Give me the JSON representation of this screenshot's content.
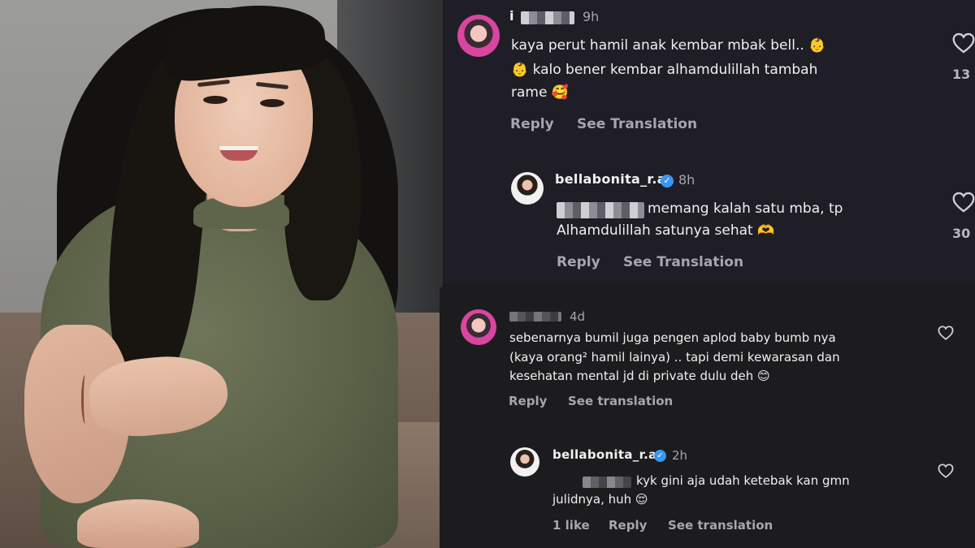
{
  "comments_top": {
    "comment": {
      "username": "i",
      "time": "9h",
      "lines": [
        "kaya perut hamil anak kembar mbak bell.. 👶",
        "👶 kalo bener kembar alhamdulillah tambah",
        "rame 🥰"
      ],
      "reply_label": "Reply",
      "translate_label": "See Translation",
      "likes": "13"
    },
    "reply": {
      "username": "bellabonita_r.a",
      "time": "8h",
      "lines": [
        "memang kalah satu mba, tp",
        "Alhamdulillah satunya sehat 🫶"
      ],
      "reply_label": "Reply",
      "translate_label": "See Translation",
      "likes": "30"
    }
  },
  "comments_bottom": {
    "comment": {
      "time": "4d",
      "lines": [
        "sebenarnya bumil juga pengen aplod baby bumb nya",
        "(kaya orang² hamil lainya) .. tapi demi kewarasan dan",
        "kesehatan mental jd di private dulu deh 😊"
      ],
      "reply_label": "Reply",
      "translate_label": "See translation"
    },
    "reply": {
      "username": "bellabonita_r.a",
      "time": "2h",
      "lines": [
        "kyk gini aja udah ketebak kan gmn",
        "julidnya, huh 😌"
      ],
      "likes_label": "1 like",
      "reply_label": "Reply",
      "translate_label": "See translation"
    }
  },
  "icons": {
    "heart": "heart-icon",
    "verified": "verified-badge-icon",
    "avatar": "avatar"
  },
  "colors": {
    "panel_top_bg": "#1f1e27",
    "panel_bottom_bg": "#1c1c1e",
    "verified": "#3897f0",
    "muted_text": "#a6a6ae"
  }
}
